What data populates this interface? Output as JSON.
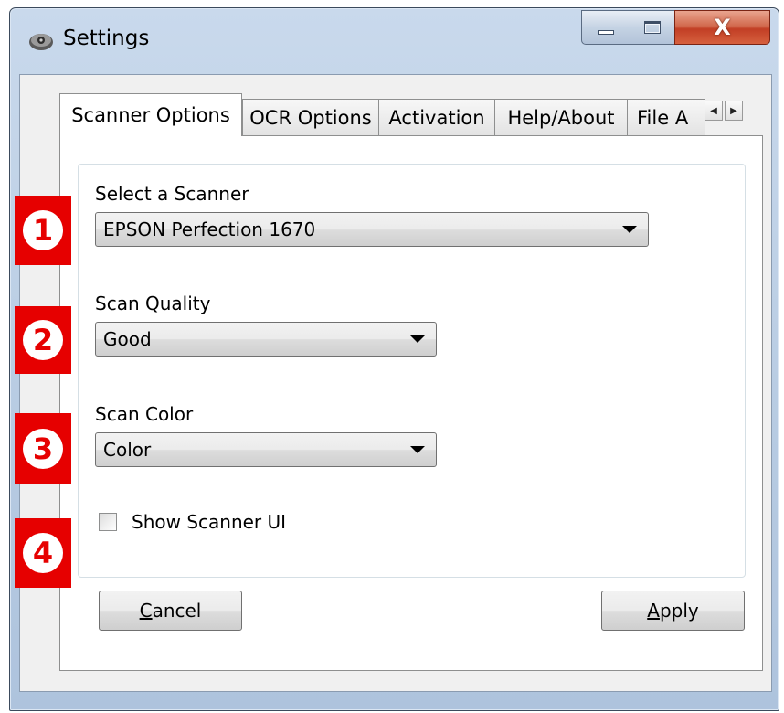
{
  "window": {
    "title": "Settings"
  },
  "titlebar": {
    "min_icon": "minimize-icon",
    "max_icon": "maximize-icon",
    "close_glyph": "X"
  },
  "tabs": [
    {
      "label": "Scanner Options",
      "active": true
    },
    {
      "label": "OCR Options",
      "active": false
    },
    {
      "label": "Activation",
      "active": false
    },
    {
      "label": "Help/About",
      "active": false
    },
    {
      "label": "File A",
      "active": false
    }
  ],
  "tab_scroll": {
    "left_glyph": "◀",
    "right_glyph": "▶"
  },
  "scanner": {
    "label": "Select a Scanner",
    "value": "EPSON Perfection 1670"
  },
  "quality": {
    "label": "Scan Quality",
    "value": "Good"
  },
  "color": {
    "label": "Scan Color",
    "value": "Color"
  },
  "show_ui": {
    "label": "Show Scanner UI",
    "checked": false
  },
  "buttons": {
    "cancel_mnemonic": "C",
    "cancel_rest": "ancel",
    "apply_mnemonic": "A",
    "apply_rest": "pply"
  },
  "markers": [
    "1",
    "2",
    "3",
    "4"
  ],
  "colors": {
    "marker_red": "#e60000",
    "titlebar": "#c9d9ec",
    "close_button": "#c23f25"
  }
}
